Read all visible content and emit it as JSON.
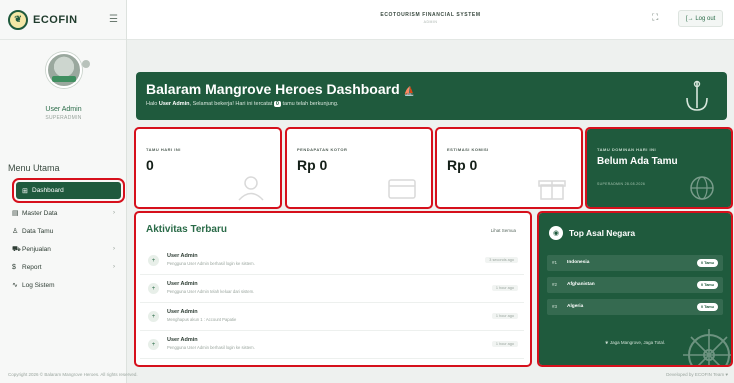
{
  "brand": {
    "name": "ECOFIN",
    "logo_icon": "leaf-logo-icon"
  },
  "profile": {
    "name": "User Admin",
    "role": "SUPERADMIN"
  },
  "sidebar": {
    "menu_title": "Menu Utama",
    "items": [
      {
        "label": "Dashboard",
        "icon": "grid-icon",
        "glyph": "⊞",
        "active": true,
        "has_children": false
      },
      {
        "label": "Master Data",
        "icon": "database-icon",
        "glyph": "▤",
        "active": false,
        "has_children": true
      },
      {
        "label": "Data Tamu",
        "icon": "users-icon",
        "glyph": "♙",
        "active": false,
        "has_children": false
      },
      {
        "label": "Penjualan",
        "icon": "cart-icon",
        "glyph": "⛟",
        "active": false,
        "has_children": true
      },
      {
        "label": "Report",
        "icon": "dollar-icon",
        "glyph": "$",
        "active": false,
        "has_children": true
      },
      {
        "label": "Log Sistem",
        "icon": "pulse-icon",
        "glyph": "∿",
        "active": false,
        "has_children": false
      }
    ]
  },
  "topbar": {
    "title": "ECOTOURISM FINANCIAL SYSTEM",
    "subtitle": "ADMIN",
    "logout_label": "[→ Log out"
  },
  "hero": {
    "title": "Balaram Mangrove Heroes Dashboard",
    "greeting_prefix": "Halo",
    "user": "User Admin",
    "greeting_mid": ", Selamat bekerja! Hari ini tercatat",
    "guest_count": "0",
    "greeting_suffix": "tamu telah berkunjung."
  },
  "stats": [
    {
      "label": "TAMU HARI INI",
      "value": "0"
    },
    {
      "label": "PENDAPATAN KOTOR",
      "value": "Rp 0"
    },
    {
      "label": "ESTIMASI KOMISI",
      "value": "Rp 0"
    },
    {
      "label": "TAMU DOMINAN HARI INI",
      "value": "Belum Ada Tamu",
      "meta": "SUPERADMIN 28.08.2026"
    }
  ],
  "activity": {
    "title": "Aktivitas Terbaru",
    "see_all": "Lihat Semua",
    "items": [
      {
        "user": "User Admin",
        "desc": "Pengguna User Admin berhasil login ke sistem.",
        "time": "3 seconds ago"
      },
      {
        "user": "User Admin",
        "desc": "Pengguna User Admin telah keluar dari sistem.",
        "time": "1 hour ago"
      },
      {
        "user": "User Admin",
        "desc": "Menghapus akun 1 : Account Papatie",
        "time": "1 hour ago"
      },
      {
        "user": "User Admin",
        "desc": "Pengguna User Admin berhasil login ke sistem.",
        "time": "1 hour ago"
      }
    ]
  },
  "countries": {
    "title": "Top Asal Negara",
    "items": [
      {
        "rank": "#1",
        "name": "Indonesia",
        "count": "0 Tamu"
      },
      {
        "rank": "#2",
        "name": "Afghanistan",
        "count": "0 Tamu"
      },
      {
        "rank": "#3",
        "name": "Algeria",
        "count": "0 Tamu"
      }
    ],
    "footer": "Jaga Mangrove, Jaga Total."
  },
  "footer": {
    "copyright": "Copyright 2026 © Balaram Mangrove Heroes. All rights reserved.",
    "developer": "Developed by ECOFIN Team ♥"
  },
  "colors": {
    "primary": "#1f5a3d",
    "highlight_outline": "#d6101c",
    "background": "#eef1ef"
  }
}
